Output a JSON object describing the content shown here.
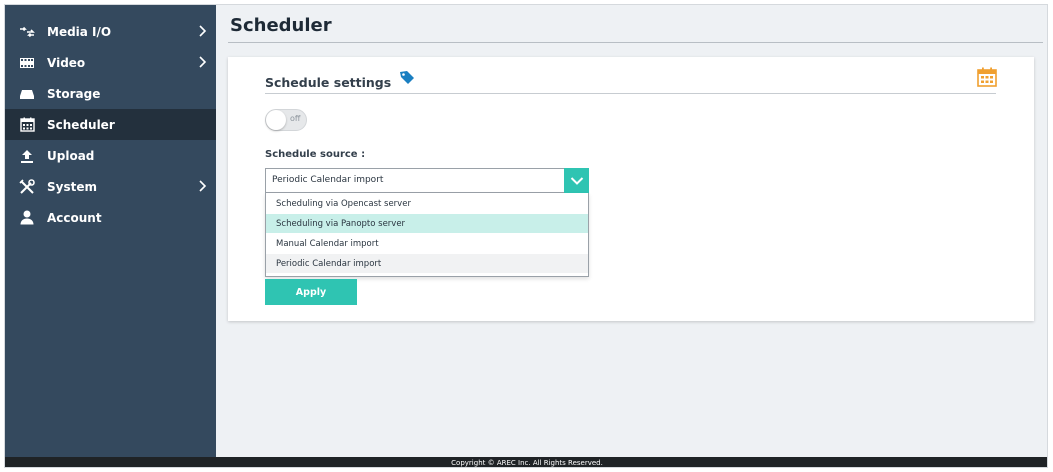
{
  "sidebar": {
    "items": [
      {
        "label": "Media I/O",
        "icon": "media-io-icon",
        "has_submenu": true,
        "active": false
      },
      {
        "label": "Video",
        "icon": "video-film-icon",
        "has_submenu": true,
        "active": false
      },
      {
        "label": "Storage",
        "icon": "storage-drive-icon",
        "has_submenu": false,
        "active": false
      },
      {
        "label": "Scheduler",
        "icon": "calendar-icon",
        "has_submenu": false,
        "active": true
      },
      {
        "label": "Upload",
        "icon": "upload-icon",
        "has_submenu": false,
        "active": false
      },
      {
        "label": "System",
        "icon": "tools-icon",
        "has_submenu": true,
        "active": false
      },
      {
        "label": "Account",
        "icon": "user-icon",
        "has_submenu": false,
        "active": false
      }
    ]
  },
  "main": {
    "title": "Scheduler",
    "card": {
      "title": "Schedule settings",
      "toggle": {
        "label": "off",
        "state": false
      },
      "source_label": "Schedule source :",
      "select": {
        "value": "Periodic Calendar import",
        "options": [
          "Scheduling via Opencast server",
          "Scheduling via Panopto server",
          "Manual Calendar import",
          "Periodic Calendar import"
        ],
        "hovered_index": 1
      },
      "apply_label": "Apply"
    }
  },
  "footer": {
    "text": "Copyright © AREC Inc. All Rights Reserved."
  },
  "colors": {
    "sidebar_bg": "#34495e",
    "sidebar_active_bg": "#23303d",
    "accent_teal": "#2fc4b2",
    "tag_icon_blue": "#1a7fc1",
    "calendar_icon_orange": "#f0a030"
  }
}
